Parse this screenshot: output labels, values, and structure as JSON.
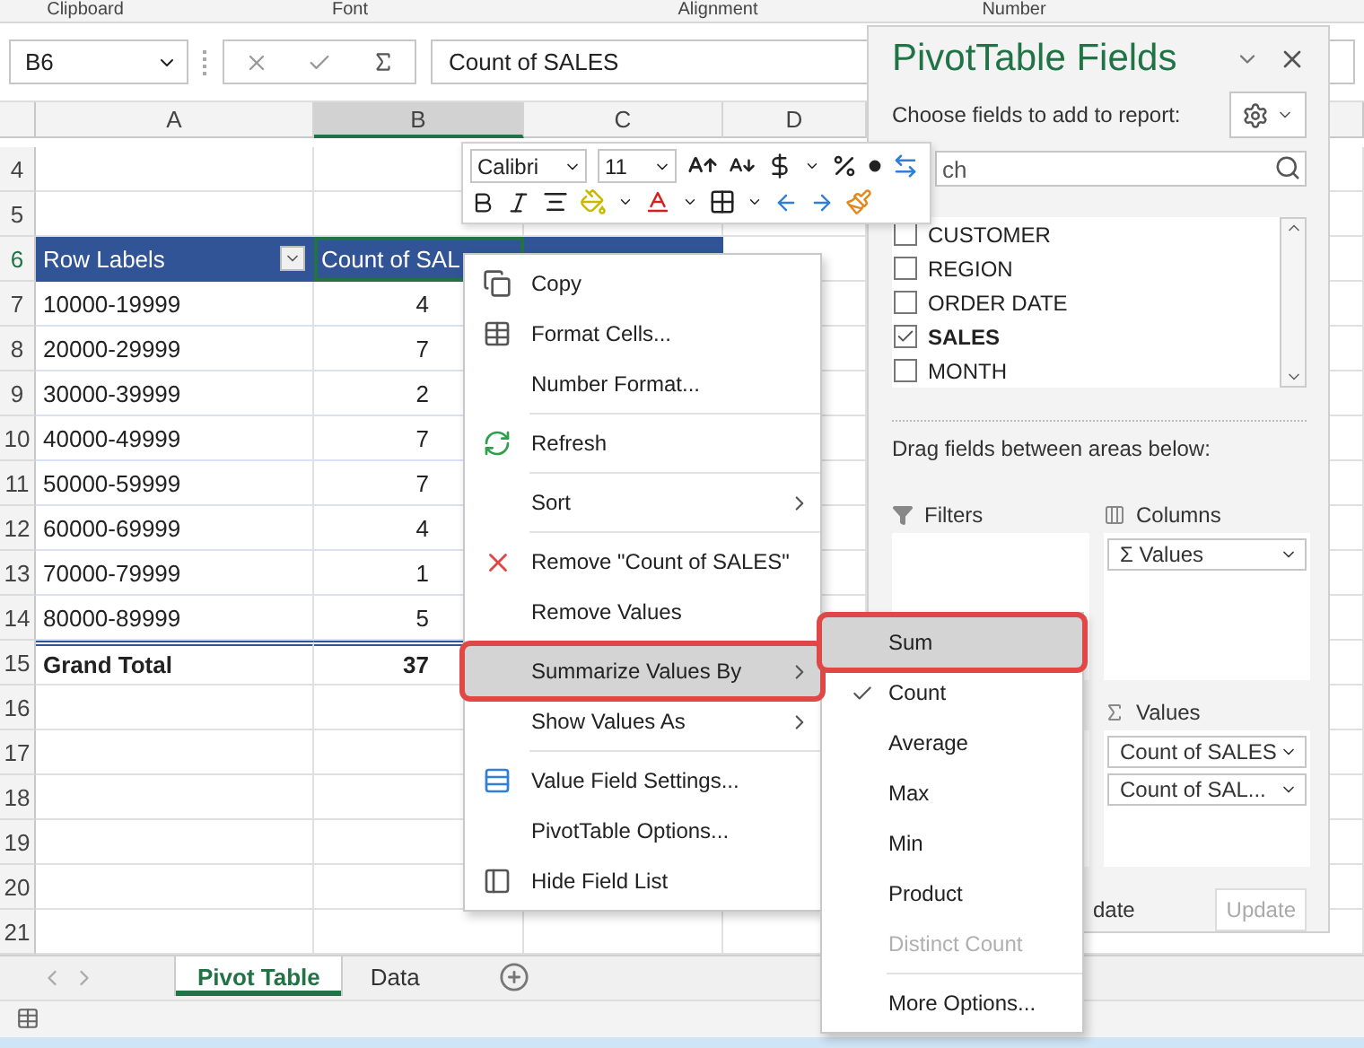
{
  "ribbon_groups": [
    "Clipboard",
    "Font",
    "Alignment",
    "Number"
  ],
  "formula_bar": {
    "name_box": "B6",
    "formula": "Count of SALES"
  },
  "columns": [
    {
      "label": "A",
      "selected": false
    },
    {
      "label": "B",
      "selected": true
    },
    {
      "label": "C",
      "selected": false
    },
    {
      "label": "D",
      "selected": false
    }
  ],
  "rows": [
    {
      "num": "4",
      "kind": "blank",
      "selected": false
    },
    {
      "num": "5",
      "kind": "blank",
      "selected": false
    },
    {
      "num": "6",
      "kind": "header",
      "label": "Row Labels",
      "value": "Count of SAL",
      "selected": true
    },
    {
      "num": "7",
      "kind": "data",
      "label": "10000-19999",
      "value": "4",
      "selected": false
    },
    {
      "num": "8",
      "kind": "data",
      "label": "20000-29999",
      "value": "7",
      "selected": false
    },
    {
      "num": "9",
      "kind": "data",
      "label": "30000-39999",
      "value": "2",
      "selected": false
    },
    {
      "num": "10",
      "kind": "data",
      "label": "40000-49999",
      "value": "7",
      "selected": false
    },
    {
      "num": "11",
      "kind": "data",
      "label": "50000-59999",
      "value": "7",
      "selected": false
    },
    {
      "num": "12",
      "kind": "data",
      "label": "60000-69999",
      "value": "4",
      "selected": false
    },
    {
      "num": "13",
      "kind": "data",
      "label": "70000-79999",
      "value": "1",
      "selected": false
    },
    {
      "num": "14",
      "kind": "data",
      "label": "80000-89999",
      "value": "5",
      "selected": false
    },
    {
      "num": "15",
      "kind": "total",
      "label": "Grand Total",
      "value": "37",
      "selected": false
    },
    {
      "num": "16",
      "kind": "blank",
      "selected": false
    },
    {
      "num": "17",
      "kind": "blank",
      "selected": false
    },
    {
      "num": "18",
      "kind": "blank",
      "selected": false
    },
    {
      "num": "19",
      "kind": "blank",
      "selected": false
    },
    {
      "num": "20",
      "kind": "blank",
      "selected": false
    },
    {
      "num": "21",
      "kind": "blank",
      "selected": false
    }
  ],
  "sheet_tabs": [
    {
      "label": "Pivot Table",
      "selected": true
    },
    {
      "label": "Data",
      "selected": false
    }
  ],
  "mini_toolbar": {
    "font": "Calibri",
    "size": "11"
  },
  "context_menu": [
    {
      "kind": "item",
      "label": "Copy",
      "submenu": false,
      "highlighted": false
    },
    {
      "kind": "item",
      "label": "Format Cells...",
      "submenu": false,
      "highlighted": false
    },
    {
      "kind": "item",
      "label": "Number Format...",
      "submenu": false,
      "highlighted": false
    },
    {
      "kind": "separator"
    },
    {
      "kind": "item",
      "label": "Refresh",
      "submenu": false,
      "highlighted": false
    },
    {
      "kind": "separator"
    },
    {
      "kind": "item",
      "label": "Sort",
      "submenu": true,
      "highlighted": false
    },
    {
      "kind": "separator"
    },
    {
      "kind": "item",
      "label": "Remove \"Count of SALES\"",
      "submenu": false,
      "highlighted": false
    },
    {
      "kind": "item",
      "label": "Remove Values",
      "submenu": false,
      "highlighted": false
    },
    {
      "kind": "separator"
    },
    {
      "kind": "item",
      "label": "Summarize Values By",
      "submenu": true,
      "highlighted": true
    },
    {
      "kind": "item",
      "label": "Show Values As",
      "submenu": true,
      "highlighted": false
    },
    {
      "kind": "separator"
    },
    {
      "kind": "item",
      "label": "Value Field Settings...",
      "submenu": false,
      "highlighted": false
    },
    {
      "kind": "item",
      "label": "PivotTable Options...",
      "submenu": false,
      "highlighted": false
    },
    {
      "kind": "item",
      "label": "Hide Field List",
      "submenu": false,
      "highlighted": false
    }
  ],
  "submenu": [
    {
      "kind": "item",
      "label": "Sum",
      "checked": false,
      "disabled": false,
      "highlighted": true
    },
    {
      "kind": "item",
      "label": "Count",
      "checked": true,
      "disabled": false,
      "highlighted": false
    },
    {
      "kind": "item",
      "label": "Average",
      "checked": false,
      "disabled": false,
      "highlighted": false
    },
    {
      "kind": "item",
      "label": "Max",
      "checked": false,
      "disabled": false,
      "highlighted": false
    },
    {
      "kind": "item",
      "label": "Min",
      "checked": false,
      "disabled": false,
      "highlighted": false
    },
    {
      "kind": "item",
      "label": "Product",
      "checked": false,
      "disabled": false,
      "highlighted": false
    },
    {
      "kind": "item",
      "label": "Distinct Count",
      "checked": false,
      "disabled": true,
      "highlighted": false
    },
    {
      "kind": "separator"
    },
    {
      "kind": "item",
      "label": "More Options...",
      "checked": false,
      "disabled": false,
      "highlighted": false
    }
  ],
  "pivot_panel": {
    "title": "PivotTable Fields",
    "choose_label": "Choose fields to add to report:",
    "search_placeholder": "ch",
    "fields": [
      {
        "name": "CUSTOMER",
        "checked": false
      },
      {
        "name": "REGION",
        "checked": false
      },
      {
        "name": "ORDER DATE",
        "checked": false
      },
      {
        "name": "SALES",
        "checked": true
      },
      {
        "name": "MONTH",
        "checked": false
      }
    ],
    "drag_label": "Drag fields between areas below:",
    "filters": {
      "title": "Filters"
    },
    "columns": {
      "title": "Columns",
      "chips": [
        "Σ Values"
      ]
    },
    "values": {
      "title": "Values",
      "chips": [
        "Count of SALES",
        "Count of SAL..."
      ]
    },
    "defer_label": "date",
    "update_button": {
      "label": "Update",
      "disabled": true
    }
  }
}
